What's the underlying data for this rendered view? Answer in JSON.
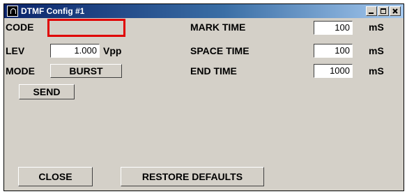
{
  "window": {
    "title": "DTMF Config #1"
  },
  "labels": {
    "code": "CODE",
    "lev": "LEV",
    "lev_unit": "Vpp",
    "mode": "MODE",
    "mark_time": "MARK TIME",
    "space_time": "SPACE TIME",
    "end_time": "END TIME",
    "ms_unit": "mS"
  },
  "fields": {
    "code": "",
    "lev": "1.000",
    "mark_time": "100",
    "space_time": "100",
    "end_time": "1000"
  },
  "mode_value": "BURST",
  "buttons": {
    "send": "SEND",
    "close": "CLOSE",
    "restore_defaults": "RESTORE DEFAULTS"
  }
}
